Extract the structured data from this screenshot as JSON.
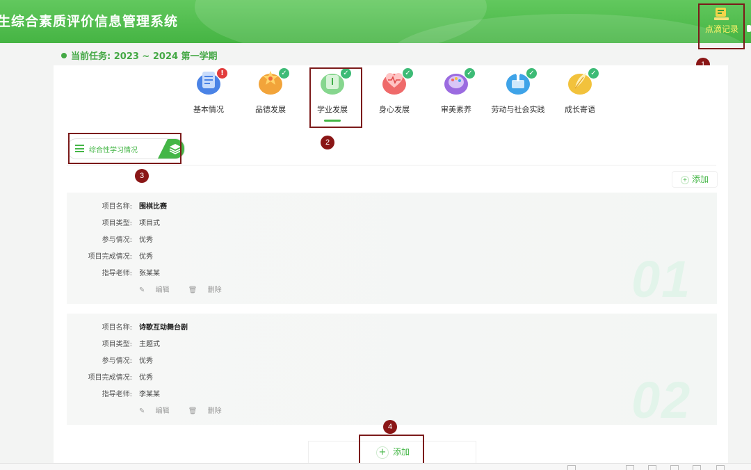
{
  "header": {
    "title": "生综合素质评价信息管理系统",
    "record_label": "点滴记录"
  },
  "task": {
    "label": "当前任务: 2023 ~ 2024 第一学期"
  },
  "nav": [
    {
      "label": "基本情况",
      "status": "warning",
      "icon": "document-icon",
      "color": "#4a83e6"
    },
    {
      "label": "品德发展",
      "status": "done",
      "icon": "star-heart-icon",
      "color": "#f2a43a"
    },
    {
      "label": "学业发展",
      "status": "done",
      "icon": "book-icon",
      "color": "#86d68e",
      "active": true
    },
    {
      "label": "身心发展",
      "status": "done",
      "icon": "heart-pulse-icon",
      "color": "#ef6a6a"
    },
    {
      "label": "审美素养",
      "status": "done",
      "icon": "palette-icon",
      "color": "#9b6be0"
    },
    {
      "label": "劳动与社会实践",
      "status": "done",
      "icon": "tools-icon",
      "color": "#3ea3e8"
    },
    {
      "label": "成长寄语",
      "status": "done",
      "icon": "feather-icon",
      "color": "#f2c23c"
    }
  ],
  "section": {
    "label": "综合性学习情况"
  },
  "add_label": "添加",
  "field_labels": {
    "name": "项目名称:",
    "type": "项目类型:",
    "participation": "参与情况:",
    "completion": "项目完成情况:",
    "teacher": "指导老师:"
  },
  "actions": {
    "edit": "编辑",
    "delete": "删除"
  },
  "cards": [
    {
      "name": "围棋比赛",
      "type": "项目式",
      "participation": "优秀",
      "completion": "优秀",
      "teacher": "张某某",
      "number": "01"
    },
    {
      "name": "诗歌互动舞台剧",
      "type": "主题式",
      "participation": "优秀",
      "completion": "优秀",
      "teacher": "李某某",
      "number": "02"
    }
  ],
  "markers": [
    "1",
    "2",
    "3",
    "4"
  ],
  "colors": {
    "brand_green": "#44b646",
    "marker_red": "#8a1616",
    "record_yellow": "#fff36a"
  }
}
